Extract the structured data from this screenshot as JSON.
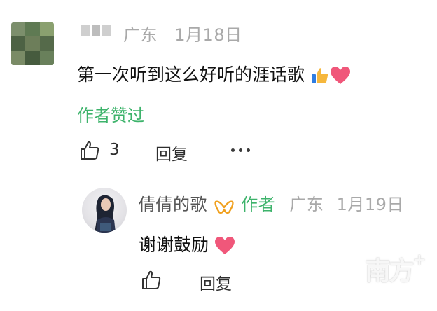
{
  "comment": {
    "location": "广东",
    "date": "1月18日",
    "text": "第一次听到这么好听的涯话歌",
    "author_liked": "作者赞过",
    "like_count": "3",
    "reply_label": "回复"
  },
  "reply": {
    "username": "倩倩的歌",
    "author_badge": "作者",
    "location": "广东",
    "date": "1月19日",
    "text": "谢谢鼓励",
    "reply_label": "回复"
  },
  "watermark": {
    "text": "南方",
    "plus": "+"
  },
  "colors": {
    "accent_green": "#3db36b",
    "meta_gray": "#a9a9a9",
    "heart_pink": "#f0577a",
    "vip_orange": "#f0a01e"
  }
}
